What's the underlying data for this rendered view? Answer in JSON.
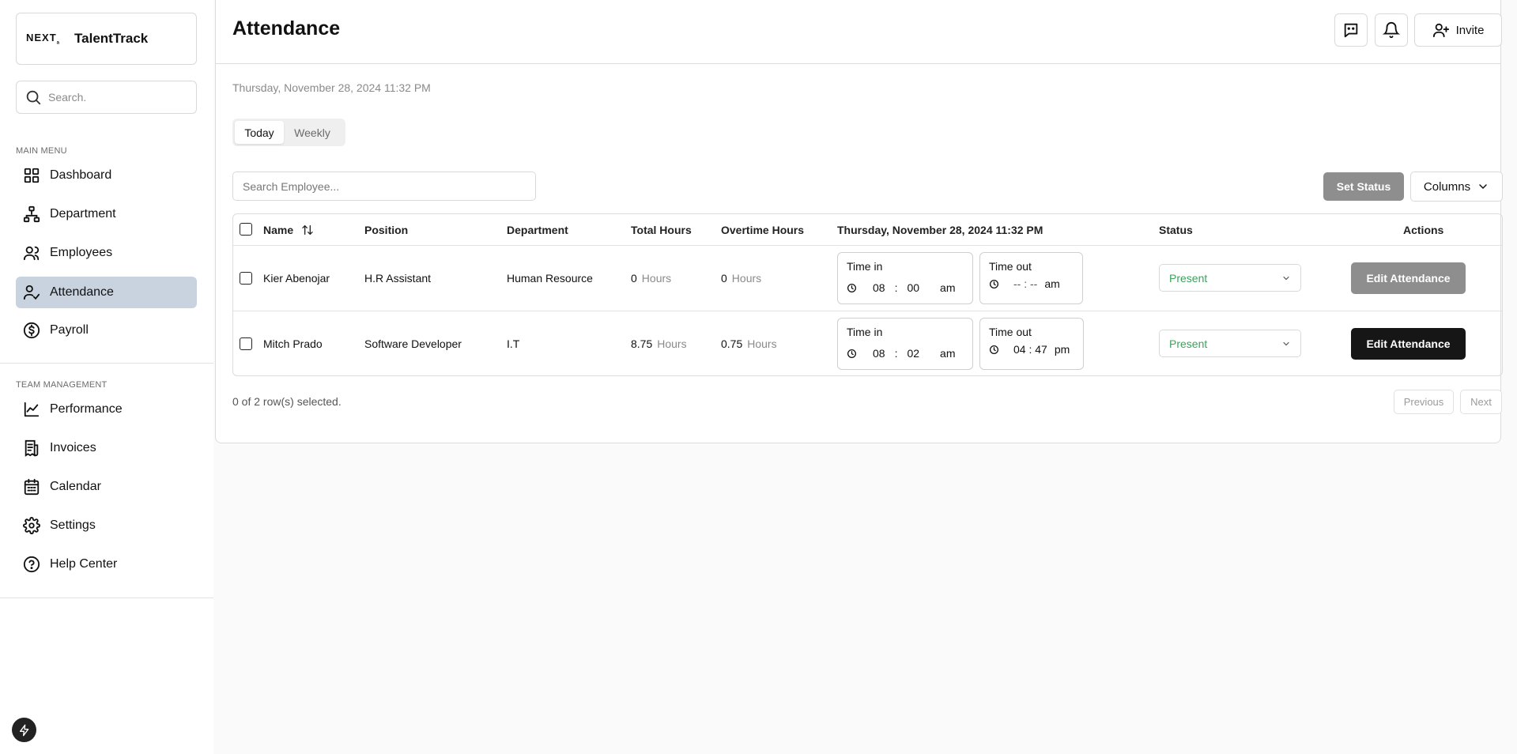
{
  "brand": {
    "logo": "NEXT",
    "logo_sub": "a",
    "name": "TalentTrack"
  },
  "sidebar": {
    "search_placeholder": "Search.",
    "main_menu_heading": "MAIN MENU",
    "main_menu": [
      {
        "label": "Dashboard",
        "icon": "grid-icon"
      },
      {
        "label": "Department",
        "icon": "org-chart-icon"
      },
      {
        "label": "Employees",
        "icon": "users-icon"
      },
      {
        "label": "Attendance",
        "icon": "user-check-icon",
        "active": true
      },
      {
        "label": "Payroll",
        "icon": "dollar-circle-icon"
      }
    ],
    "team_heading": "TEAM MANAGEMENT",
    "team_menu": [
      {
        "label": "Performance",
        "icon": "line-chart-icon"
      },
      {
        "label": "Invoices",
        "icon": "receipt-icon"
      },
      {
        "label": "Calendar",
        "icon": "calendar-icon"
      },
      {
        "label": "Settings",
        "icon": "gear-icon"
      },
      {
        "label": "Help Center",
        "icon": "help-circle-icon"
      }
    ]
  },
  "header": {
    "title": "Attendance",
    "invite_label": "Invite"
  },
  "datetime": "Thursday, November 28, 2024 11:32 PM",
  "tabs": [
    "Today",
    "Weekly"
  ],
  "toolbar": {
    "search_placeholder": "Search Employee...",
    "set_status_label": "Set Status",
    "columns_label": "Columns"
  },
  "table": {
    "columns": [
      "Name",
      "Position",
      "Department",
      "Total Hours",
      "Overtime Hours",
      "Thursday, November 28, 2024 11:32 PM",
      "Status",
      "Actions"
    ],
    "hours_unit": "Hours",
    "time_in_label": "Time in",
    "time_out_label": "Time out",
    "rows": [
      {
        "name": "Kier Abenojar",
        "position": "H.R Assistant",
        "department": "Human Resource",
        "total_hours": "0",
        "overtime_hours": "0",
        "time_in": {
          "hh": "08",
          "mm": "00",
          "ampm": "am"
        },
        "time_out": {
          "display": "-- : --",
          "ampm": "am"
        },
        "status": "Present",
        "action": "Edit Attendance"
      },
      {
        "name": "Mitch Prado",
        "position": "Software Developer",
        "department": "I.T",
        "total_hours": "8.75",
        "overtime_hours": "0.75",
        "time_in": {
          "hh": "08",
          "mm": "02",
          "ampm": "am"
        },
        "time_out": {
          "display": "04 : 47",
          "ampm": "pm"
        },
        "status": "Present",
        "action": "Edit Attendance"
      }
    ]
  },
  "footer": {
    "rows_selected": "0 of 2 row(s) selected.",
    "previous_label": "Previous",
    "next_label": "Next"
  },
  "colors": {
    "active_nav": "#c9d3e0",
    "status_present": "#3aa35c",
    "primary_button": "#161616",
    "disabled_button": "#8e8e8e"
  }
}
